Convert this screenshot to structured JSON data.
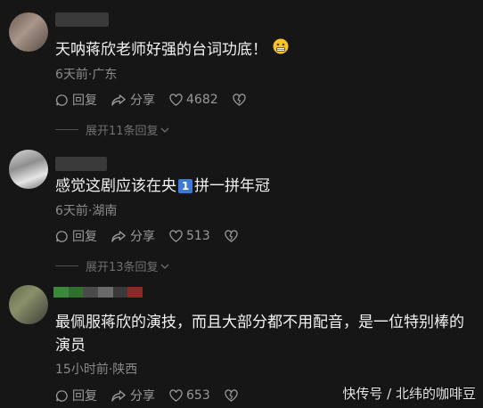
{
  "colors": {
    "background": "#161616",
    "text": "#f2f2f2",
    "meta": "#8a8a8a",
    "action": "#9a9a9a",
    "expand": "#6f6f6f",
    "badge": "#3b78d8"
  },
  "comments": [
    {
      "text": "天呐蒋欣老师好强的台词功底！",
      "emoji": "grimacing-face-emoji",
      "meta": "6天前·广东",
      "reply_label": "回复",
      "share_label": "分享",
      "likes": "4682",
      "expand_label": "展开11条回复"
    },
    {
      "text_before": "感觉这剧应该在央",
      "badge": "1",
      "text_after": "拼一拼年冠",
      "meta": "6天前·湖南",
      "reply_label": "回复",
      "share_label": "分享",
      "likes": "513",
      "expand_label": "展开13条回复"
    },
    {
      "text": "最佩服蒋欣的演技，而且大部分都不用配音，是一位特别棒的演员",
      "meta": "15小时前·陕西",
      "reply_label": "回复",
      "share_label": "分享",
      "likes": "653"
    }
  ],
  "watermark": "快传号 / 北纬的咖啡豆"
}
